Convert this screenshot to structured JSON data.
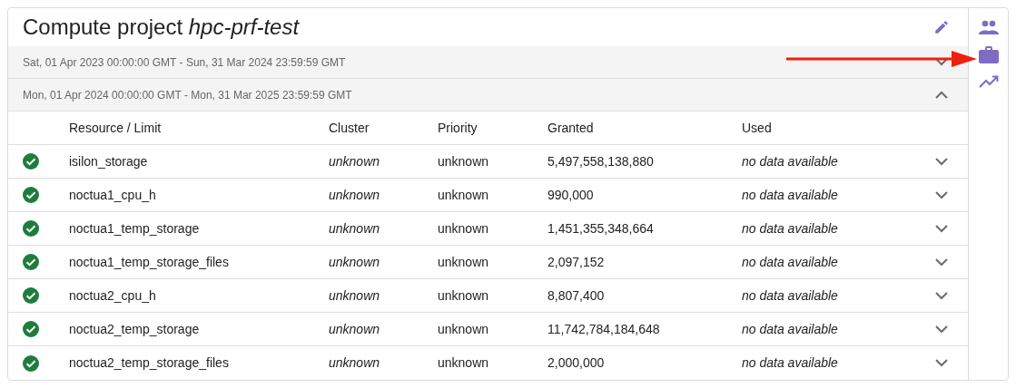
{
  "project": {
    "title_prefix": "Compute project",
    "title_name": "hpc-prf-test"
  },
  "periods": [
    {
      "label": "Sat, 01 Apr 2023 00:00:00 GMT - Sun, 31 Mar 2024 23:59:59 GMT",
      "expanded": false
    },
    {
      "label": "Mon, 01 Apr 2024 00:00:00 GMT - Mon, 31 Mar 2025 23:59:59 GMT",
      "expanded": true,
      "columns": [
        "Resource / Limit",
        "Cluster",
        "Priority",
        "Granted",
        "Used"
      ],
      "rows": [
        {
          "active": true,
          "resource": "isilon_storage",
          "cluster": "unknown",
          "priority": "unknown",
          "granted": "5,497,558,138,880",
          "used": "no data available",
          "expanded": false
        },
        {
          "active": true,
          "resource": "noctua1_cpu_h",
          "cluster": "unknown",
          "priority": "unknown",
          "granted": "990,000",
          "used": "no data available",
          "expanded": false
        },
        {
          "active": true,
          "resource": "noctua1_temp_storage",
          "cluster": "unknown",
          "priority": "unknown",
          "granted": "1,451,355,348,664",
          "used": "no data available",
          "expanded": false
        },
        {
          "active": true,
          "resource": "noctua1_temp_storage_files",
          "cluster": "unknown",
          "priority": "unknown",
          "granted": "2,097,152",
          "used": "no data available",
          "expanded": false
        },
        {
          "active": true,
          "resource": "noctua2_cpu_h",
          "cluster": "unknown",
          "priority": "unknown",
          "granted": "8,807,400",
          "used": "no data available",
          "expanded": false
        },
        {
          "active": true,
          "resource": "noctua2_temp_storage",
          "cluster": "unknown",
          "priority": "unknown",
          "granted": "11,742,784,184,648",
          "used": "no data available",
          "expanded": false
        },
        {
          "active": true,
          "resource": "noctua2_temp_storage_files",
          "cluster": "unknown",
          "priority": "unknown",
          "granted": "2,000,000",
          "used": "no data available",
          "expanded": false
        }
      ]
    }
  ]
}
